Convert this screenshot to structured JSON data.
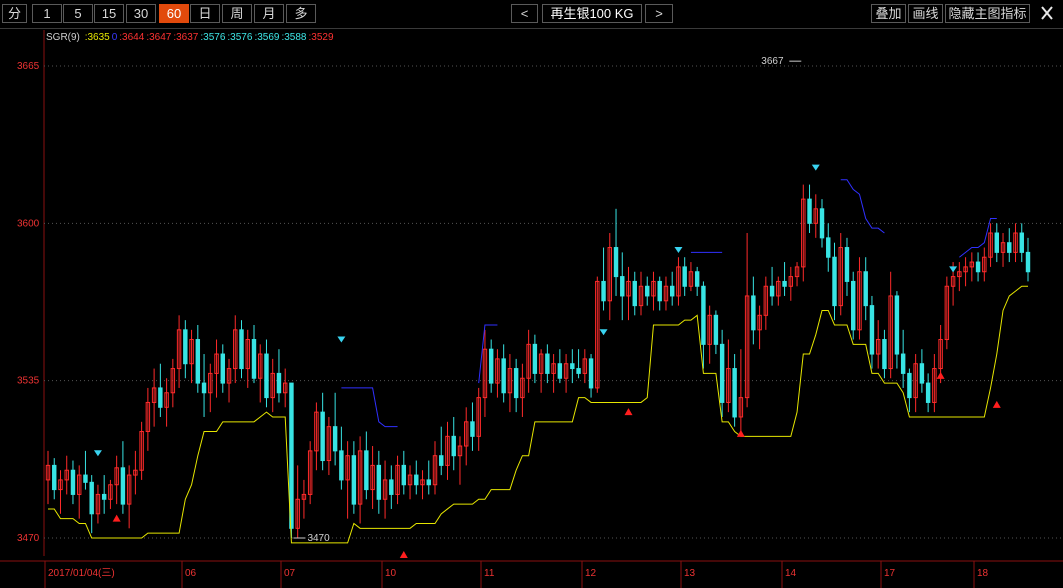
{
  "toolbar": {
    "periods": [
      "分",
      "1",
      "5",
      "15",
      "30",
      "60",
      "日",
      "周",
      "月",
      "多"
    ],
    "active_period": "60",
    "prev_label": "<",
    "next_label": ">",
    "instrument": "再生银100 KG",
    "right_buttons": [
      "叠加",
      "画线",
      "隐藏主图指标"
    ]
  },
  "legend": {
    "name": "SGR(9)",
    "items": [
      {
        "text": ":3635",
        "color": "#e8e800"
      },
      {
        "text": "0",
        "color": "#3a3aff"
      },
      {
        "text": ":3644",
        "color": "#ff3232"
      },
      {
        "text": ":3647",
        "color": "#ff3232"
      },
      {
        "text": ":3637",
        "color": "#ff3232"
      },
      {
        "text": ":3576",
        "color": "#3ee6e6"
      },
      {
        "text": ":3576",
        "color": "#3ee6e6"
      },
      {
        "text": ":3569",
        "color": "#3ee6e6"
      },
      {
        "text": ":3588",
        "color": "#3ee6e6"
      },
      {
        "text": ":3529",
        "color": "#ff3232"
      }
    ]
  },
  "chart_data": {
    "type": "bar",
    "y_ticks": [
      3665,
      3600,
      3535,
      3470
    ],
    "ylim": [
      3448,
      3680
    ],
    "x_labels": [
      "2017/01/04(三)",
      "06",
      "07",
      "10",
      "11",
      "12",
      "13",
      "14",
      "17",
      "18"
    ],
    "annotations": [
      {
        "text": "3667",
        "value": 3667
      },
      {
        "text": "3470",
        "value": 3470
      }
    ],
    "grid": true,
    "colors": {
      "up": "#ff2a2a",
      "down": "#38e4e4",
      "support": "#e6e600",
      "resistance": "#3030ff",
      "grid": "#555555",
      "axis_label": "#ff3333"
    },
    "bars": [
      {
        "o": 3494,
        "h": 3506,
        "l": 3484,
        "c": 3500
      },
      {
        "o": 3500,
        "h": 3503,
        "l": 3486,
        "c": 3490
      },
      {
        "o": 3490,
        "h": 3498,
        "l": 3480,
        "c": 3494
      },
      {
        "o": 3494,
        "h": 3504,
        "l": 3488,
        "c": 3498
      },
      {
        "o": 3498,
        "h": 3502,
        "l": 3484,
        "c": 3488
      },
      {
        "o": 3488,
        "h": 3500,
        "l": 3478,
        "c": 3496
      },
      {
        "o": 3496,
        "h": 3506,
        "l": 3490,
        "c": 3493
      },
      {
        "o": 3493,
        "h": 3496,
        "l": 3472,
        "c": 3480
      },
      {
        "o": 3480,
        "h": 3492,
        "l": 3476,
        "c": 3488
      },
      {
        "o": 3488,
        "h": 3496,
        "l": 3480,
        "c": 3486
      },
      {
        "o": 3486,
        "h": 3494,
        "l": 3482,
        "c": 3492
      },
      {
        "o": 3492,
        "h": 3504,
        "l": 3484,
        "c": 3499
      },
      {
        "o": 3499,
        "h": 3510,
        "l": 3480,
        "c": 3484
      },
      {
        "o": 3484,
        "h": 3500,
        "l": 3474,
        "c": 3496
      },
      {
        "o": 3496,
        "h": 3506,
        "l": 3488,
        "c": 3498
      },
      {
        "o": 3498,
        "h": 3518,
        "l": 3494,
        "c": 3514
      },
      {
        "o": 3514,
        "h": 3532,
        "l": 3506,
        "c": 3526
      },
      {
        "o": 3526,
        "h": 3540,
        "l": 3516,
        "c": 3532
      },
      {
        "o": 3532,
        "h": 3542,
        "l": 3520,
        "c": 3524
      },
      {
        "o": 3524,
        "h": 3536,
        "l": 3516,
        "c": 3530
      },
      {
        "o": 3530,
        "h": 3544,
        "l": 3524,
        "c": 3540
      },
      {
        "o": 3540,
        "h": 3562,
        "l": 3532,
        "c": 3556
      },
      {
        "o": 3556,
        "h": 3560,
        "l": 3536,
        "c": 3542
      },
      {
        "o": 3542,
        "h": 3556,
        "l": 3534,
        "c": 3552
      },
      {
        "o": 3552,
        "h": 3558,
        "l": 3530,
        "c": 3534
      },
      {
        "o": 3534,
        "h": 3546,
        "l": 3520,
        "c": 3530
      },
      {
        "o": 3530,
        "h": 3542,
        "l": 3522,
        "c": 3538
      },
      {
        "o": 3538,
        "h": 3552,
        "l": 3528,
        "c": 3546
      },
      {
        "o": 3546,
        "h": 3550,
        "l": 3530,
        "c": 3534
      },
      {
        "o": 3534,
        "h": 3544,
        "l": 3526,
        "c": 3540
      },
      {
        "o": 3540,
        "h": 3562,
        "l": 3534,
        "c": 3556
      },
      {
        "o": 3556,
        "h": 3560,
        "l": 3536,
        "c": 3540
      },
      {
        "o": 3540,
        "h": 3556,
        "l": 3532,
        "c": 3552
      },
      {
        "o": 3552,
        "h": 3558,
        "l": 3534,
        "c": 3536
      },
      {
        "o": 3536,
        "h": 3550,
        "l": 3526,
        "c": 3546
      },
      {
        "o": 3546,
        "h": 3552,
        "l": 3524,
        "c": 3528
      },
      {
        "o": 3528,
        "h": 3544,
        "l": 3522,
        "c": 3538
      },
      {
        "o": 3538,
        "h": 3548,
        "l": 3526,
        "c": 3530
      },
      {
        "o": 3530,
        "h": 3540,
        "l": 3524,
        "c": 3534
      },
      {
        "o": 3534,
        "h": 3530,
        "l": 3470,
        "c": 3474
      },
      {
        "o": 3474,
        "h": 3500,
        "l": 3470,
        "c": 3486
      },
      {
        "o": 3486,
        "h": 3494,
        "l": 3478,
        "c": 3488
      },
      {
        "o": 3488,
        "h": 3510,
        "l": 3484,
        "c": 3506
      },
      {
        "o": 3506,
        "h": 3526,
        "l": 3498,
        "c": 3522
      },
      {
        "o": 3522,
        "h": 3530,
        "l": 3498,
        "c": 3502
      },
      {
        "o": 3502,
        "h": 3520,
        "l": 3496,
        "c": 3516
      },
      {
        "o": 3516,
        "h": 3530,
        "l": 3500,
        "c": 3506
      },
      {
        "o": 3506,
        "h": 3516,
        "l": 3490,
        "c": 3494
      },
      {
        "o": 3494,
        "h": 3510,
        "l": 3478,
        "c": 3504
      },
      {
        "o": 3504,
        "h": 3510,
        "l": 3480,
        "c": 3484
      },
      {
        "o": 3484,
        "h": 3512,
        "l": 3476,
        "c": 3506
      },
      {
        "o": 3506,
        "h": 3514,
        "l": 3486,
        "c": 3490
      },
      {
        "o": 3490,
        "h": 3508,
        "l": 3482,
        "c": 3500
      },
      {
        "o": 3500,
        "h": 3506,
        "l": 3480,
        "c": 3486
      },
      {
        "o": 3486,
        "h": 3502,
        "l": 3478,
        "c": 3494
      },
      {
        "o": 3494,
        "h": 3500,
        "l": 3482,
        "c": 3488
      },
      {
        "o": 3488,
        "h": 3504,
        "l": 3484,
        "c": 3500
      },
      {
        "o": 3500,
        "h": 3506,
        "l": 3488,
        "c": 3492
      },
      {
        "o": 3492,
        "h": 3500,
        "l": 3486,
        "c": 3496
      },
      {
        "o": 3496,
        "h": 3502,
        "l": 3488,
        "c": 3492
      },
      {
        "o": 3492,
        "h": 3498,
        "l": 3486,
        "c": 3494
      },
      {
        "o": 3494,
        "h": 3502,
        "l": 3488,
        "c": 3492
      },
      {
        "o": 3492,
        "h": 3510,
        "l": 3488,
        "c": 3504
      },
      {
        "o": 3504,
        "h": 3516,
        "l": 3496,
        "c": 3500
      },
      {
        "o": 3500,
        "h": 3518,
        "l": 3494,
        "c": 3512
      },
      {
        "o": 3512,
        "h": 3520,
        "l": 3498,
        "c": 3504
      },
      {
        "o": 3504,
        "h": 3512,
        "l": 3492,
        "c": 3508
      },
      {
        "o": 3508,
        "h": 3524,
        "l": 3500,
        "c": 3518
      },
      {
        "o": 3518,
        "h": 3526,
        "l": 3506,
        "c": 3512
      },
      {
        "o": 3512,
        "h": 3532,
        "l": 3506,
        "c": 3528
      },
      {
        "o": 3528,
        "h": 3556,
        "l": 3520,
        "c": 3548
      },
      {
        "o": 3548,
        "h": 3552,
        "l": 3530,
        "c": 3534
      },
      {
        "o": 3534,
        "h": 3548,
        "l": 3528,
        "c": 3544
      },
      {
        "o": 3544,
        "h": 3550,
        "l": 3526,
        "c": 3530
      },
      {
        "o": 3530,
        "h": 3546,
        "l": 3522,
        "c": 3540
      },
      {
        "o": 3540,
        "h": 3544,
        "l": 3522,
        "c": 3528
      },
      {
        "o": 3528,
        "h": 3542,
        "l": 3520,
        "c": 3536
      },
      {
        "o": 3536,
        "h": 3556,
        "l": 3530,
        "c": 3550
      },
      {
        "o": 3550,
        "h": 3554,
        "l": 3534,
        "c": 3538
      },
      {
        "o": 3538,
        "h": 3548,
        "l": 3530,
        "c": 3546
      },
      {
        "o": 3546,
        "h": 3550,
        "l": 3534,
        "c": 3538
      },
      {
        "o": 3538,
        "h": 3546,
        "l": 3530,
        "c": 3542
      },
      {
        "o": 3542,
        "h": 3548,
        "l": 3534,
        "c": 3536
      },
      {
        "o": 3536,
        "h": 3546,
        "l": 3530,
        "c": 3542
      },
      {
        "o": 3542,
        "h": 3548,
        "l": 3534,
        "c": 3540
      },
      {
        "o": 3540,
        "h": 3548,
        "l": 3536,
        "c": 3538
      },
      {
        "o": 3538,
        "h": 3548,
        "l": 3534,
        "c": 3544
      },
      {
        "o": 3544,
        "h": 3546,
        "l": 3528,
        "c": 3532
      },
      {
        "o": 3532,
        "h": 3578,
        "l": 3530,
        "c": 3576
      },
      {
        "o": 3576,
        "h": 3590,
        "l": 3564,
        "c": 3568
      },
      {
        "o": 3568,
        "h": 3596,
        "l": 3560,
        "c": 3590
      },
      {
        "o": 3590,
        "h": 3606,
        "l": 3570,
        "c": 3578
      },
      {
        "o": 3578,
        "h": 3588,
        "l": 3560,
        "c": 3570
      },
      {
        "o": 3570,
        "h": 3582,
        "l": 3560,
        "c": 3576
      },
      {
        "o": 3576,
        "h": 3580,
        "l": 3562,
        "c": 3566
      },
      {
        "o": 3566,
        "h": 3580,
        "l": 3562,
        "c": 3574
      },
      {
        "o": 3574,
        "h": 3578,
        "l": 3566,
        "c": 3570
      },
      {
        "o": 3570,
        "h": 3580,
        "l": 3564,
        "c": 3576
      },
      {
        "o": 3576,
        "h": 3578,
        "l": 3564,
        "c": 3568
      },
      {
        "o": 3568,
        "h": 3578,
        "l": 3564,
        "c": 3574
      },
      {
        "o": 3574,
        "h": 3580,
        "l": 3566,
        "c": 3570
      },
      {
        "o": 3570,
        "h": 3586,
        "l": 3566,
        "c": 3582
      },
      {
        "o": 3582,
        "h": 3586,
        "l": 3570,
        "c": 3574
      },
      {
        "o": 3574,
        "h": 3584,
        "l": 3572,
        "c": 3580
      },
      {
        "o": 3580,
        "h": 3582,
        "l": 3570,
        "c": 3574
      },
      {
        "o": 3574,
        "h": 3576,
        "l": 3540,
        "c": 3550
      },
      {
        "o": 3550,
        "h": 3566,
        "l": 3542,
        "c": 3562
      },
      {
        "o": 3562,
        "h": 3564,
        "l": 3546,
        "c": 3550
      },
      {
        "o": 3550,
        "h": 3556,
        "l": 3520,
        "c": 3526
      },
      {
        "o": 3526,
        "h": 3552,
        "l": 3522,
        "c": 3540
      },
      {
        "o": 3540,
        "h": 3546,
        "l": 3516,
        "c": 3520
      },
      {
        "o": 3520,
        "h": 3548,
        "l": 3514,
        "c": 3528
      },
      {
        "o": 3528,
        "h": 3596,
        "l": 3524,
        "c": 3570
      },
      {
        "o": 3570,
        "h": 3578,
        "l": 3550,
        "c": 3556
      },
      {
        "o": 3556,
        "h": 3566,
        "l": 3548,
        "c": 3562
      },
      {
        "o": 3562,
        "h": 3578,
        "l": 3556,
        "c": 3574
      },
      {
        "o": 3574,
        "h": 3582,
        "l": 3566,
        "c": 3570
      },
      {
        "o": 3570,
        "h": 3578,
        "l": 3566,
        "c": 3576
      },
      {
        "o": 3576,
        "h": 3584,
        "l": 3570,
        "c": 3574
      },
      {
        "o": 3574,
        "h": 3582,
        "l": 3568,
        "c": 3578
      },
      {
        "o": 3578,
        "h": 3584,
        "l": 3574,
        "c": 3582
      },
      {
        "o": 3582,
        "h": 3616,
        "l": 3576,
        "c": 3610
      },
      {
        "o": 3610,
        "h": 3616,
        "l": 3596,
        "c": 3600
      },
      {
        "o": 3600,
        "h": 3612,
        "l": 3594,
        "c": 3606
      },
      {
        "o": 3606,
        "h": 3610,
        "l": 3590,
        "c": 3594
      },
      {
        "o": 3594,
        "h": 3600,
        "l": 3580,
        "c": 3586
      },
      {
        "o": 3586,
        "h": 3592,
        "l": 3560,
        "c": 3566
      },
      {
        "o": 3566,
        "h": 3596,
        "l": 3562,
        "c": 3590
      },
      {
        "o": 3590,
        "h": 3594,
        "l": 3570,
        "c": 3576
      },
      {
        "o": 3576,
        "h": 3580,
        "l": 3552,
        "c": 3556
      },
      {
        "o": 3556,
        "h": 3586,
        "l": 3552,
        "c": 3580
      },
      {
        "o": 3580,
        "h": 3586,
        "l": 3560,
        "c": 3566
      },
      {
        "o": 3566,
        "h": 3570,
        "l": 3540,
        "c": 3546
      },
      {
        "o": 3546,
        "h": 3560,
        "l": 3540,
        "c": 3552
      },
      {
        "o": 3552,
        "h": 3556,
        "l": 3536,
        "c": 3540
      },
      {
        "o": 3540,
        "h": 3580,
        "l": 3536,
        "c": 3570
      },
      {
        "o": 3570,
        "h": 3572,
        "l": 3540,
        "c": 3546
      },
      {
        "o": 3546,
        "h": 3556,
        "l": 3532,
        "c": 3538
      },
      {
        "o": 3538,
        "h": 3540,
        "l": 3522,
        "c": 3528
      },
      {
        "o": 3528,
        "h": 3546,
        "l": 3522,
        "c": 3542
      },
      {
        "o": 3542,
        "h": 3548,
        "l": 3530,
        "c": 3534
      },
      {
        "o": 3534,
        "h": 3538,
        "l": 3522,
        "c": 3526
      },
      {
        "o": 3526,
        "h": 3546,
        "l": 3522,
        "c": 3540
      },
      {
        "o": 3540,
        "h": 3558,
        "l": 3534,
        "c": 3552
      },
      {
        "o": 3552,
        "h": 3578,
        "l": 3548,
        "c": 3574
      },
      {
        "o": 3574,
        "h": 3584,
        "l": 3566,
        "c": 3578
      },
      {
        "o": 3578,
        "h": 3584,
        "l": 3572,
        "c": 3580
      },
      {
        "o": 3580,
        "h": 3586,
        "l": 3574,
        "c": 3582
      },
      {
        "o": 3582,
        "h": 3588,
        "l": 3576,
        "c": 3584
      },
      {
        "o": 3584,
        "h": 3588,
        "l": 3576,
        "c": 3580
      },
      {
        "o": 3580,
        "h": 3590,
        "l": 3576,
        "c": 3586
      },
      {
        "o": 3586,
        "h": 3600,
        "l": 3582,
        "c": 3596
      },
      {
        "o": 3596,
        "h": 3600,
        "l": 3584,
        "c": 3588
      },
      {
        "o": 3588,
        "h": 3596,
        "l": 3582,
        "c": 3592
      },
      {
        "o": 3592,
        "h": 3598,
        "l": 3584,
        "c": 3588
      },
      {
        "o": 3588,
        "h": 3600,
        "l": 3584,
        "c": 3596
      },
      {
        "o": 3596,
        "h": 3600,
        "l": 3584,
        "c": 3588
      },
      {
        "o": 3588,
        "h": 3594,
        "l": 3576,
        "c": 3580
      }
    ]
  }
}
